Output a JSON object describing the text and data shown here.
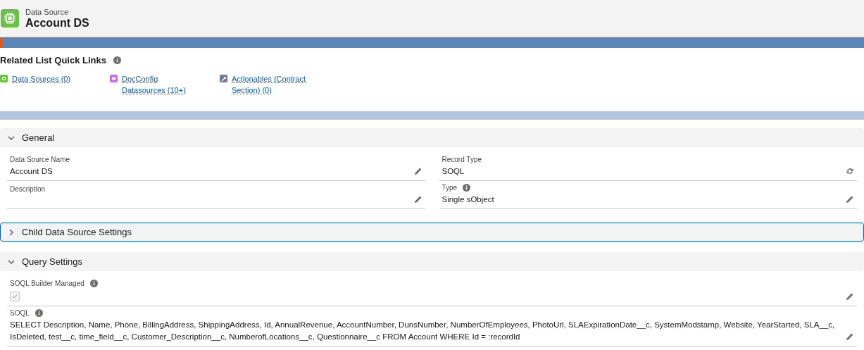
{
  "header": {
    "object_label": "Data Source",
    "title": "Account DS"
  },
  "quick_links": {
    "title": "Related List Quick Links",
    "links": [
      {
        "label": "Data Sources (0)",
        "color": "#6cc04a"
      },
      {
        "label": "DocConfig Datasources (10+)",
        "color": "#c86cf0"
      },
      {
        "label": "Actionables (Contract Section) (0)",
        "color": "#6b7a99"
      }
    ]
  },
  "sections": [
    {
      "title": "General",
      "kind": "two-column",
      "expanded": true,
      "focused": false,
      "fields": [
        {
          "label": "Data Source Name",
          "kind": "text",
          "value": "Account DS",
          "info": false
        },
        {
          "label": "Record Type",
          "kind": "record-type",
          "value": "SOQL",
          "info": false
        },
        {
          "label": "Description",
          "kind": "text",
          "info": false
        },
        {
          "label": "Type",
          "kind": "text",
          "value": "Single sObject",
          "info": true
        }
      ]
    },
    {
      "title": "Child Data Source Settings",
      "expanded": false,
      "focused": true
    },
    {
      "title": "Query Settings",
      "kind": "full-width",
      "expanded": true,
      "focused": false,
      "fields": [
        {
          "label": "SOQL Builder Managed",
          "kind": "checkbox",
          "checked": true,
          "info": true
        },
        {
          "label": "SOQL",
          "kind": "text",
          "value": "SELECT Description, Name, Phone, BillingAddress, ShippingAddress, Id, AnnualRevenue, AccountNumber, DunsNumber, NumberOfEmployees, PhotoUrl, SLAExpirationDate__c, SystemModstamp, Website, YearStarted, SLA__c, IsDeleted, test__c, time_field__c, Customer_Description__c, NumberofLocations__c, Questionnaire__c FROM Account WHERE Id = :recordId",
          "info": true
        }
      ]
    }
  ]
}
